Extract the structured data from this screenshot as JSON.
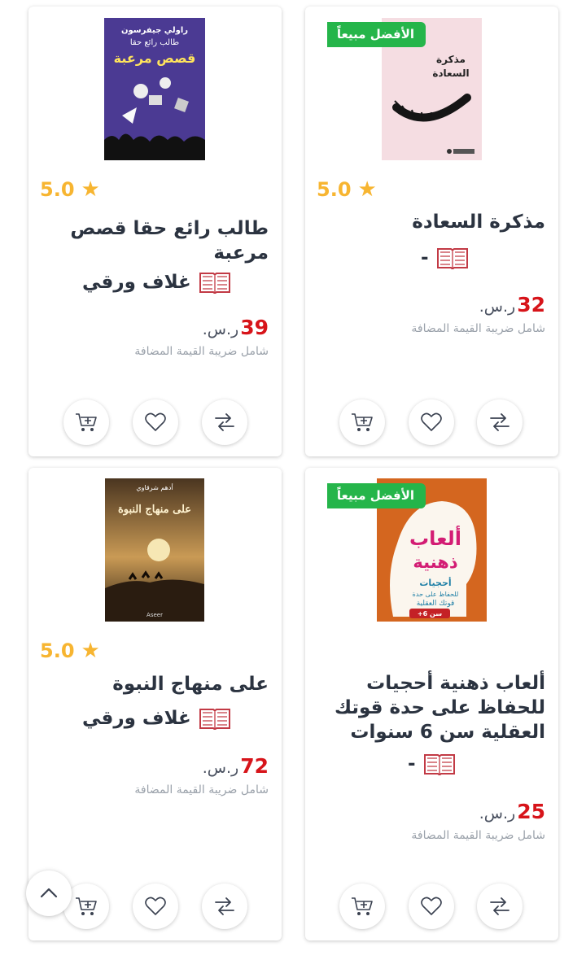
{
  "products": [
    {
      "best_seller": "الأفضل مبيعاً",
      "rating": "5.0",
      "title": "مذكرة السعادة",
      "format": "-",
      "price": "32",
      "currency": "ر.س.",
      "vat_note": "شامل ضريبة القيمة المضافة",
      "cover_lines": [
        "مذكرة",
        "السعادة"
      ]
    },
    {
      "best_seller": "",
      "rating": "5.0",
      "title": "طالب رائع حقا قصص مرعبة",
      "format": "غلاف ورقي",
      "price": "39",
      "currency": "ر.س.",
      "vat_note": "شامل ضريبة القيمة المضافة",
      "cover_lines": [
        "راولي جيفرسون",
        "طالب رائع حقا",
        "قصص مرعبة"
      ]
    },
    {
      "best_seller": "الأفضل مبيعاً",
      "rating": "",
      "title": "ألعاب ذهنية أحجيات للحفاظ على حدة قوتك العقلية سن 6 سنوات",
      "format": "-",
      "price": "25",
      "currency": "ر.س.",
      "vat_note": "شامل ضريبة القيمة المضافة",
      "cover_lines": [
        "ألعاب",
        "ذهنية",
        "أحجيات",
        "للحفاظ على حدة",
        "قوتك العقلية",
        "سن 6+"
      ]
    },
    {
      "best_seller": "",
      "rating": "5.0",
      "title": "على منهاج النبوة",
      "format": "غلاف ورقي",
      "price": "72",
      "currency": "ر.س.",
      "vat_note": "شامل ضريبة القيمة المضافة",
      "cover_lines": [
        "أدهم شرقاوي",
        "على منهاج النبوة",
        "Aseer"
      ]
    }
  ],
  "icons": {
    "rating": "star-icon",
    "format": "open-book-icon",
    "compare": "compare-arrows-icon",
    "wishlist": "heart-icon",
    "cart": "add-to-cart-icon",
    "scroll_top": "chevron-up-icon"
  },
  "colors": {
    "badge": "#25b54a",
    "star": "#f7b531",
    "price": "#d7141a",
    "book_icon": "#c23a45"
  }
}
